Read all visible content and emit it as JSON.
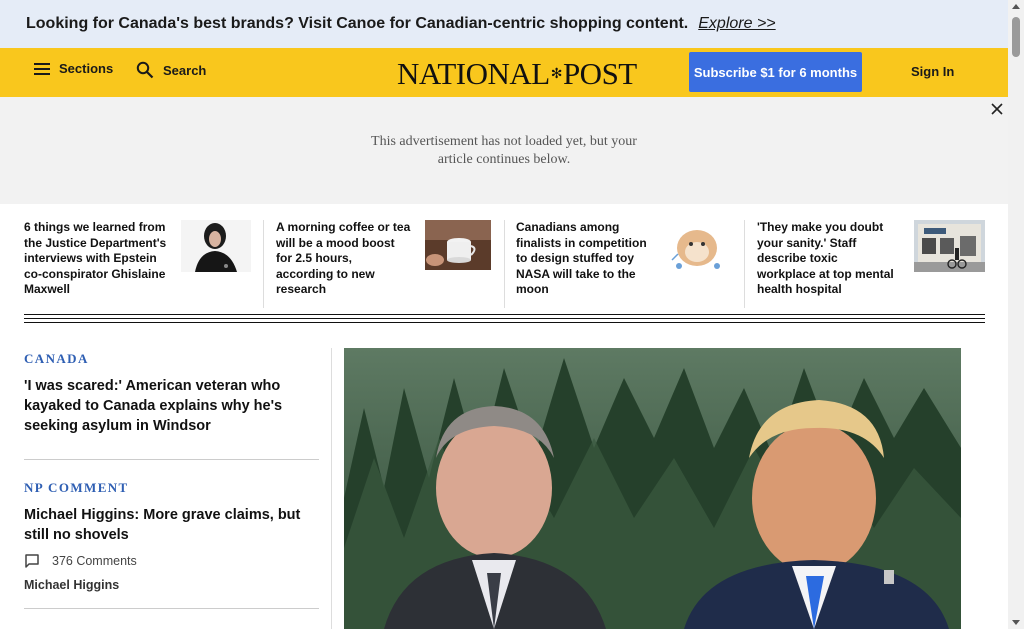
{
  "promo": {
    "text": "Looking for Canada's best brands? Visit Canoe for Canadian-centric shopping content.",
    "link": "Explore >>"
  },
  "header": {
    "sections_label": "Sections",
    "search_label": "Search",
    "logo_left": "NATIONAL",
    "logo_right": "POST",
    "subscribe_label": "Subscribe $1 for 6 months",
    "signin_label": "Sign In"
  },
  "ad": {
    "line1": "This advertisement has not loaded yet, but your",
    "line2": "article continues below."
  },
  "strip": [
    {
      "title": "6 things we learned from the Justice Department's interviews with Epstein co-conspirator Ghislaine Maxwell",
      "thumb_icon": "portrait-photo"
    },
    {
      "title": "A morning coffee or tea will be a mood boost for 2.5 hours, according to new research",
      "thumb_icon": "coffee-cup-photo"
    },
    {
      "title": "Canadians among finalists in competition to design stuffed toy NASA will take to the moon",
      "thumb_icon": "plush-toy-illustration"
    },
    {
      "title": "'They make you doubt your sanity.' Staff describe toxic workplace at top mental health hospital",
      "thumb_icon": "building-photo"
    }
  ],
  "left": {
    "story1": {
      "kicker": "CANADA",
      "headline": "'I was scared:' American veteran who kayaked to Canada explains why he's seeking asylum in Windsor"
    },
    "story2": {
      "kicker": "NP COMMENT",
      "headline": "Michael Higgins: More grave claims, but still no shovels",
      "comments": "376 Comments",
      "author": "Michael Higgins"
    }
  },
  "colors": {
    "header_bg": "#f9c71d",
    "promo_bg": "#e5ecf7",
    "subscribe_bg": "#3a6ee0",
    "kicker": "#2f5fb3"
  }
}
